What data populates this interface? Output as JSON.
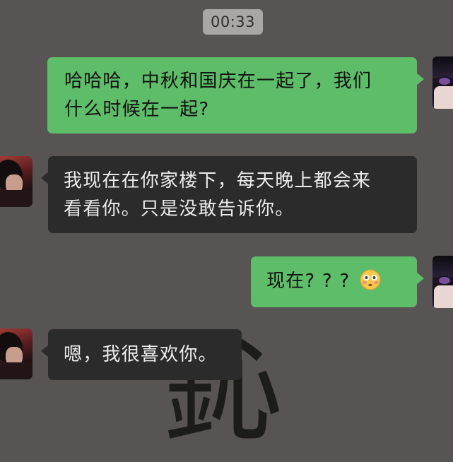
{
  "conversation": {
    "timestamp": "00:33",
    "background_mark": "鈊",
    "messages": [
      {
        "id": "m1",
        "sender": "me",
        "text": "哈哈哈，中秋和国庆在一起了，我们什么时候在一起?",
        "lines": [
          "哈哈哈，中秋和国庆在一起了，我们",
          "什么时候在一起?"
        ]
      },
      {
        "id": "m2",
        "sender": "contact",
        "text": "我现在在你家楼下，每天晚上都会来看看你。只是没敢告诉你。",
        "lines": [
          "我现在在你家楼下，每天晚上都会来",
          "看看你。只是没敢告诉你。"
        ]
      },
      {
        "id": "m3",
        "sender": "me",
        "text": "现在? ? ?",
        "emoji": "flushed-face-emoji"
      },
      {
        "id": "m4",
        "sender": "contact",
        "text": "嗯，我很喜欢你。"
      }
    ]
  },
  "colors": {
    "background": "#575453",
    "outgoing_bubble": "#5ebd69",
    "incoming_bubble": "#2b2b2b",
    "timestamp_pill": "#a9a7a6"
  }
}
